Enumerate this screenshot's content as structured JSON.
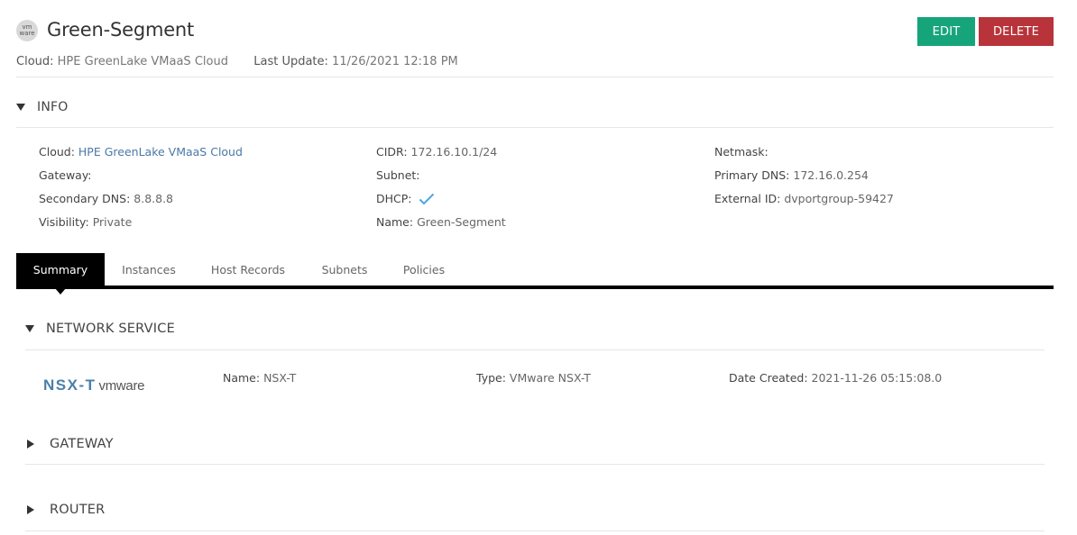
{
  "header": {
    "logo_text": "vm ware",
    "title": "Green-Segment",
    "cloud_label": "Cloud:",
    "cloud_value": "HPE GreenLake VMaaS Cloud",
    "last_update_label": "Last Update:",
    "last_update_value": "11/26/2021 12:18 PM",
    "edit_label": "EDIT",
    "delete_label": "DELETE"
  },
  "info": {
    "section_label": "INFO",
    "cloud_label": "Cloud:",
    "cloud_value": "HPE GreenLake VMaaS Cloud",
    "gateway_label": "Gateway:",
    "gateway_value": "",
    "secondary_dns_label": "Secondary DNS:",
    "secondary_dns_value": "8.8.8.8",
    "visibility_label": "Visibility:",
    "visibility_value": "Private",
    "cidr_label": "CIDR:",
    "cidr_value": "172.16.10.1/24",
    "subnet_label": "Subnet:",
    "subnet_value": "",
    "dhcp_label": "DHCP:",
    "dhcp_icon": "check-icon",
    "name_label": "Name:",
    "name_value": "Green-Segment",
    "netmask_label": "Netmask:",
    "netmask_value": "",
    "primary_dns_label": "Primary DNS:",
    "primary_dns_value": "172.16.0.254",
    "external_id_label": "External ID:",
    "external_id_value": "dvportgroup-59427"
  },
  "tabs": [
    {
      "label": "Summary",
      "active": true
    },
    {
      "label": "Instances",
      "active": false
    },
    {
      "label": "Host Records",
      "active": false
    },
    {
      "label": "Subnets",
      "active": false
    },
    {
      "label": "Policies",
      "active": false
    }
  ],
  "network_service": {
    "section_label": "NETWORK SERVICE",
    "logo_nsx": "NSX-T",
    "logo_vmware": "vmware",
    "name_label": "Name:",
    "name_value": "NSX-T",
    "type_label": "Type:",
    "type_value": "VMware NSX-T",
    "date_created_label": "Date Created:",
    "date_created_value": "2021-11-26 05:15:08.0"
  },
  "gateway_section": {
    "label": "GATEWAY"
  },
  "router_section": {
    "label": "ROUTER"
  },
  "colors": {
    "edit": "#16a57a",
    "delete": "#b8343a",
    "link": "#4a78a8",
    "check": "#4aa8e0"
  }
}
